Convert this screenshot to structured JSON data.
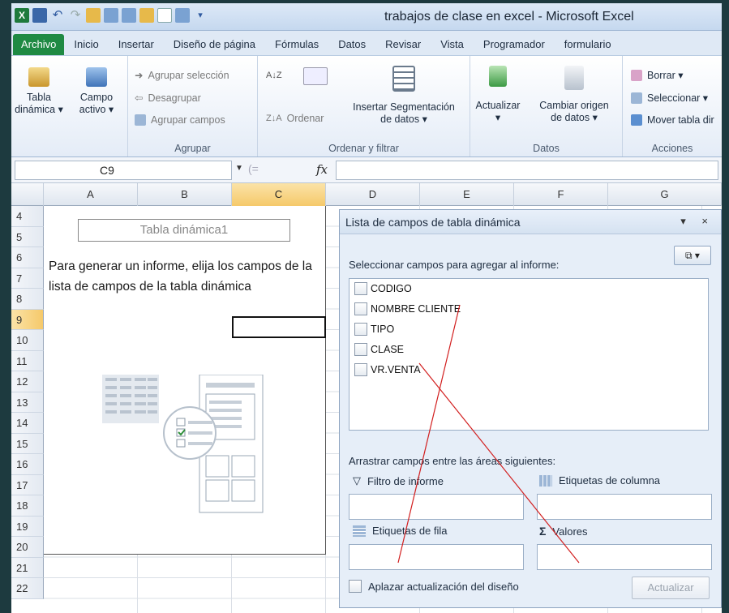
{
  "window": {
    "title": "trabajos de clase en excel  -  Microsoft Excel"
  },
  "ribbon_tabs": [
    "Archivo",
    "Inicio",
    "Insertar",
    "Diseño de página",
    "Fórmulas",
    "Datos",
    "Revisar",
    "Vista",
    "Programador",
    "formulario"
  ],
  "ribbon": {
    "tabla_dinamica": {
      "line1": "Tabla",
      "line2": "dinámica ▾"
    },
    "campo_activo": {
      "line1": "Campo",
      "line2": "activo ▾"
    },
    "agrupar": {
      "seleccion": "Agrupar selección",
      "desagrupar": "Desagrupar",
      "campos": "Agrupar campos",
      "label": "Agrupar"
    },
    "ordenar": {
      "ordenar": "Ordenar",
      "segmentacion_1": "Insertar Segmentación",
      "segmentacion_2": "de datos ▾",
      "label": "Ordenar y filtrar"
    },
    "datos": {
      "actualizar_1": "Actualizar",
      "actualizar_2": "▾",
      "cambiar_1": "Cambiar origen",
      "cambiar_2": "de datos ▾",
      "label": "Datos"
    },
    "acciones": {
      "borrar": "Borrar ▾",
      "seleccionar": "Seleccionar ▾",
      "mover": "Mover tabla dir",
      "label": "Acciones"
    }
  },
  "formula_bar": {
    "name_box": "C9",
    "fx": "fx",
    "value": ""
  },
  "columns": [
    "A",
    "B",
    "C",
    "D",
    "E",
    "F",
    "G"
  ],
  "selected_column": "C",
  "rows": [
    "4",
    "5",
    "6",
    "7",
    "8",
    "9",
    "10",
    "11",
    "12",
    "13",
    "14",
    "15",
    "16",
    "17",
    "18",
    "19",
    "20",
    "21",
    "22"
  ],
  "selected_row": "9",
  "pivot_placeholder": {
    "title": "Tabla dinámica1",
    "message": "Para generar un informe, elija los campos de la lista de campos de la tabla dinámica"
  },
  "field_list": {
    "title": "Lista de campos de tabla dinámica",
    "controls": "▾ ×",
    "layout_button": "⧉ ▾",
    "select_label": "Seleccionar campos para agregar al informe:",
    "fields": [
      "CODIGO",
      "NOMBRE CLIENTE",
      "TIPO",
      "CLASE",
      "VR.VENTA"
    ],
    "drag_label": "Arrastrar campos entre las áreas siguientes:",
    "zones": {
      "filter": "Filtro de informe",
      "columns": "Etiquetas de columna",
      "rows": "Etiquetas de fila",
      "values": "Valores"
    },
    "defer_label": "Aplazar actualización del diseño",
    "update_button": "Actualizar"
  },
  "colors": {
    "file_tab": "#1f8a43",
    "selection": "#f5c96a",
    "annotation": "#d21f1f"
  }
}
